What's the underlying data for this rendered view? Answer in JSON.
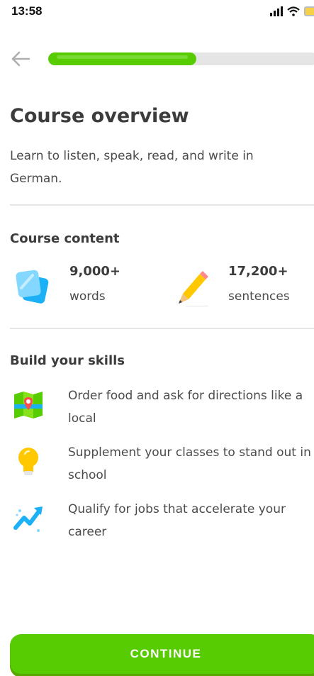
{
  "status_bar": {
    "time": "13:58"
  },
  "progress": {
    "fraction": 0.55
  },
  "title": "Course overview",
  "intro": "Learn to listen, speak, read, and write in German.",
  "course_content": {
    "heading": "Course content",
    "stats": [
      {
        "value": "9,000+",
        "label": "words",
        "icon": "cards-icon"
      },
      {
        "value": "17,200+",
        "label": "sentences",
        "icon": "pencil-icon"
      }
    ]
  },
  "skills": {
    "heading": "Build your skills",
    "items": [
      {
        "text": "Order food and ask for directions like a local",
        "icon": "map-icon"
      },
      {
        "text": "Supplement your classes to stand out in school",
        "icon": "lightbulb-icon"
      },
      {
        "text": "Qualify for jobs that accelerate your career",
        "icon": "growth-chart-icon"
      }
    ]
  },
  "continue_label": "CONTINUE",
  "colors": {
    "accent": "#58cc02",
    "accent_shadow": "#58a700",
    "track": "#e5e5e5"
  }
}
